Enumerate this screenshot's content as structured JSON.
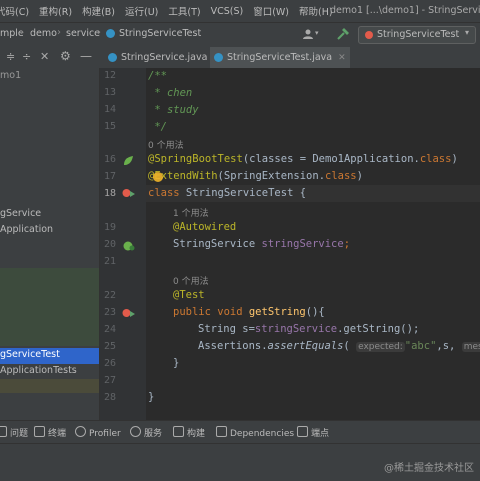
{
  "menu": {
    "items": [
      "代码(C)",
      "重构(R)",
      "构建(B)",
      "运行(U)",
      "工具(T)",
      "VCS(S)",
      "窗口(W)",
      "帮助(H)"
    ],
    "window_title": "demo1 [...\\demo1] - StringServiceTe"
  },
  "nav": {
    "crumbs": [
      "mple",
      "demo",
      "service",
      "StringServiceTest"
    ],
    "run_config": "StringServiceTest"
  },
  "tabs": [
    {
      "label": "StringService.java",
      "active": false
    },
    {
      "label": "StringServiceTest.java",
      "active": true
    }
  ],
  "project": {
    "items": [
      "mo1",
      "gService",
      "Application",
      "gServiceTest",
      "ApplicationTests"
    ]
  },
  "editor": {
    "line_numbers": [
      "12",
      "13",
      "14",
      "15",
      "",
      "16",
      "17",
      "18",
      "",
      "19",
      "20",
      "21",
      "",
      "22",
      "23",
      "24",
      "25",
      "26",
      "27",
      "28"
    ],
    "hint_usages_0": "0 个用法",
    "hint_usages_1": "1 个用法",
    "c12": "/**",
    "c13": " * chen",
    "c14": " * study",
    "c15": " */",
    "l16_ann": "@SpringBootTest",
    "l16_rest": "(classes = Demo1Application.",
    "l16_kw": "class",
    "l16_end": ")",
    "l17_ann": "@ExtendWith",
    "l17_rest": "(SpringExtension.",
    "l17_kw": "class",
    "l17_end": ")",
    "l18_kw": "class",
    "l18_cls": " StringServiceTest ",
    "l18_brace": "{",
    "l19_ann": "@Autowired",
    "l20_type": "StringService ",
    "l20_field": "stringService",
    "l20_end": ";",
    "l22_ann": "@Test",
    "l23_kw": "public void ",
    "l23_fn": "getString",
    "l23_end": "(){",
    "l24_a": "String s=",
    "l24_field": "stringService",
    "l24_b": ".getString();",
    "l25_a": "Assertions.",
    "l25_fn": "assertEquals",
    "l25_p": "(",
    "l25_hint1": "expected:",
    "l25_str": "\"abc\"",
    "l25_b": ",s,",
    "l25_hint2": "mess",
    "l26": "}",
    "l28": "}"
  },
  "toolwindows": [
    "问题",
    "终端",
    "Profiler",
    "服务",
    "构建",
    "Dependencies",
    "端点"
  ],
  "watermark": "@稀土掘金技术社区",
  "colors": {
    "accent": "#4a88c7",
    "selection": "#2f65ca",
    "comment": "#629755",
    "keyword": "#cc7832",
    "annotation": "#bbb529"
  }
}
